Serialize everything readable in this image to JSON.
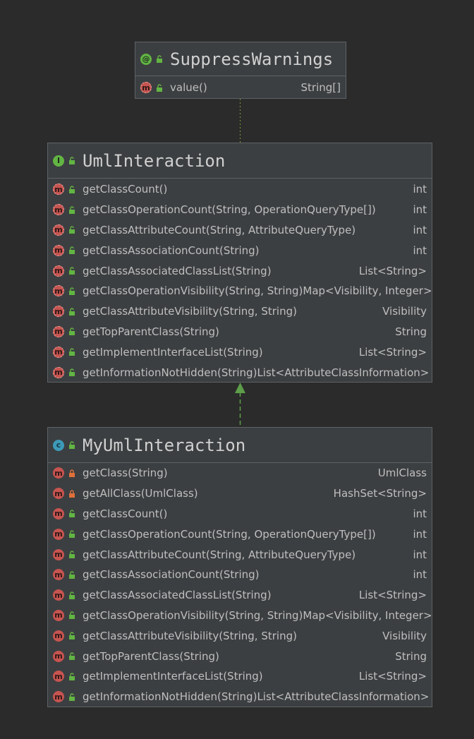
{
  "annotation": {
    "name": "SuppressWarnings",
    "icon": "annotation-icon",
    "methods": [
      {
        "name": "value()",
        "type": "String[]"
      }
    ]
  },
  "interface": {
    "name": "UmlInteraction",
    "icon": "interface-icon",
    "methods": [
      {
        "name": "getClassCount()",
        "type": "int"
      },
      {
        "name": "getClassOperationCount(String, OperationQueryType[])",
        "type": "int"
      },
      {
        "name": "getClassAttributeCount(String, AttributeQueryType)",
        "type": "int"
      },
      {
        "name": "getClassAssociationCount(String)",
        "type": "int"
      },
      {
        "name": "getClassAssociatedClassList(String)",
        "type": "List<String>"
      },
      {
        "name": "getClassOperationVisibility(String, String)",
        "type": "Map<Visibility, Integer>"
      },
      {
        "name": "getClassAttributeVisibility(String, String)",
        "type": "Visibility"
      },
      {
        "name": "getTopParentClass(String)",
        "type": "String"
      },
      {
        "name": "getImplementInterfaceList(String)",
        "type": "List<String>"
      },
      {
        "name": "getInformationNotHidden(String)",
        "type": "List<AttributeClassInformation>"
      }
    ]
  },
  "class": {
    "name": "MyUmlInteraction",
    "icon": "class-icon",
    "methods": [
      {
        "name": "getClass(String)",
        "type": "UmlClass",
        "private": true
      },
      {
        "name": "getAllClass(UmlClass)",
        "type": "HashSet<String>",
        "private": true
      },
      {
        "name": "getClassCount()",
        "type": "int"
      },
      {
        "name": "getClassOperationCount(String, OperationQueryType[])",
        "type": "int"
      },
      {
        "name": "getClassAttributeCount(String, AttributeQueryType)",
        "type": "int"
      },
      {
        "name": "getClassAssociationCount(String)",
        "type": "int"
      },
      {
        "name": "getClassAssociatedClassList(String)",
        "type": "List<String>"
      },
      {
        "name": "getClassOperationVisibility(String, String)",
        "type": "Map<Visibility, Integer>"
      },
      {
        "name": "getClassAttributeVisibility(String, String)",
        "type": "Visibility"
      },
      {
        "name": "getTopParentClass(String)",
        "type": "String"
      },
      {
        "name": "getImplementInterfaceList(String)",
        "type": "List<String>"
      },
      {
        "name": "getInformationNotHidden(String)",
        "type": "List<AttributeClassInformation>"
      }
    ]
  },
  "colors": {
    "background": "#2b2b2b",
    "box": "#3c3f41",
    "border": "#5e6265",
    "public_lock": "#62b543",
    "private_lock": "#e0703a",
    "method_icon": "#c75450",
    "class_icon": "#3d9ab8",
    "interface_icon": "#62b543",
    "realization_arrow": "#5d9e4a"
  },
  "icon_glyphs": {
    "annotation": "@",
    "interface": "I",
    "class": "c",
    "method": "m"
  }
}
